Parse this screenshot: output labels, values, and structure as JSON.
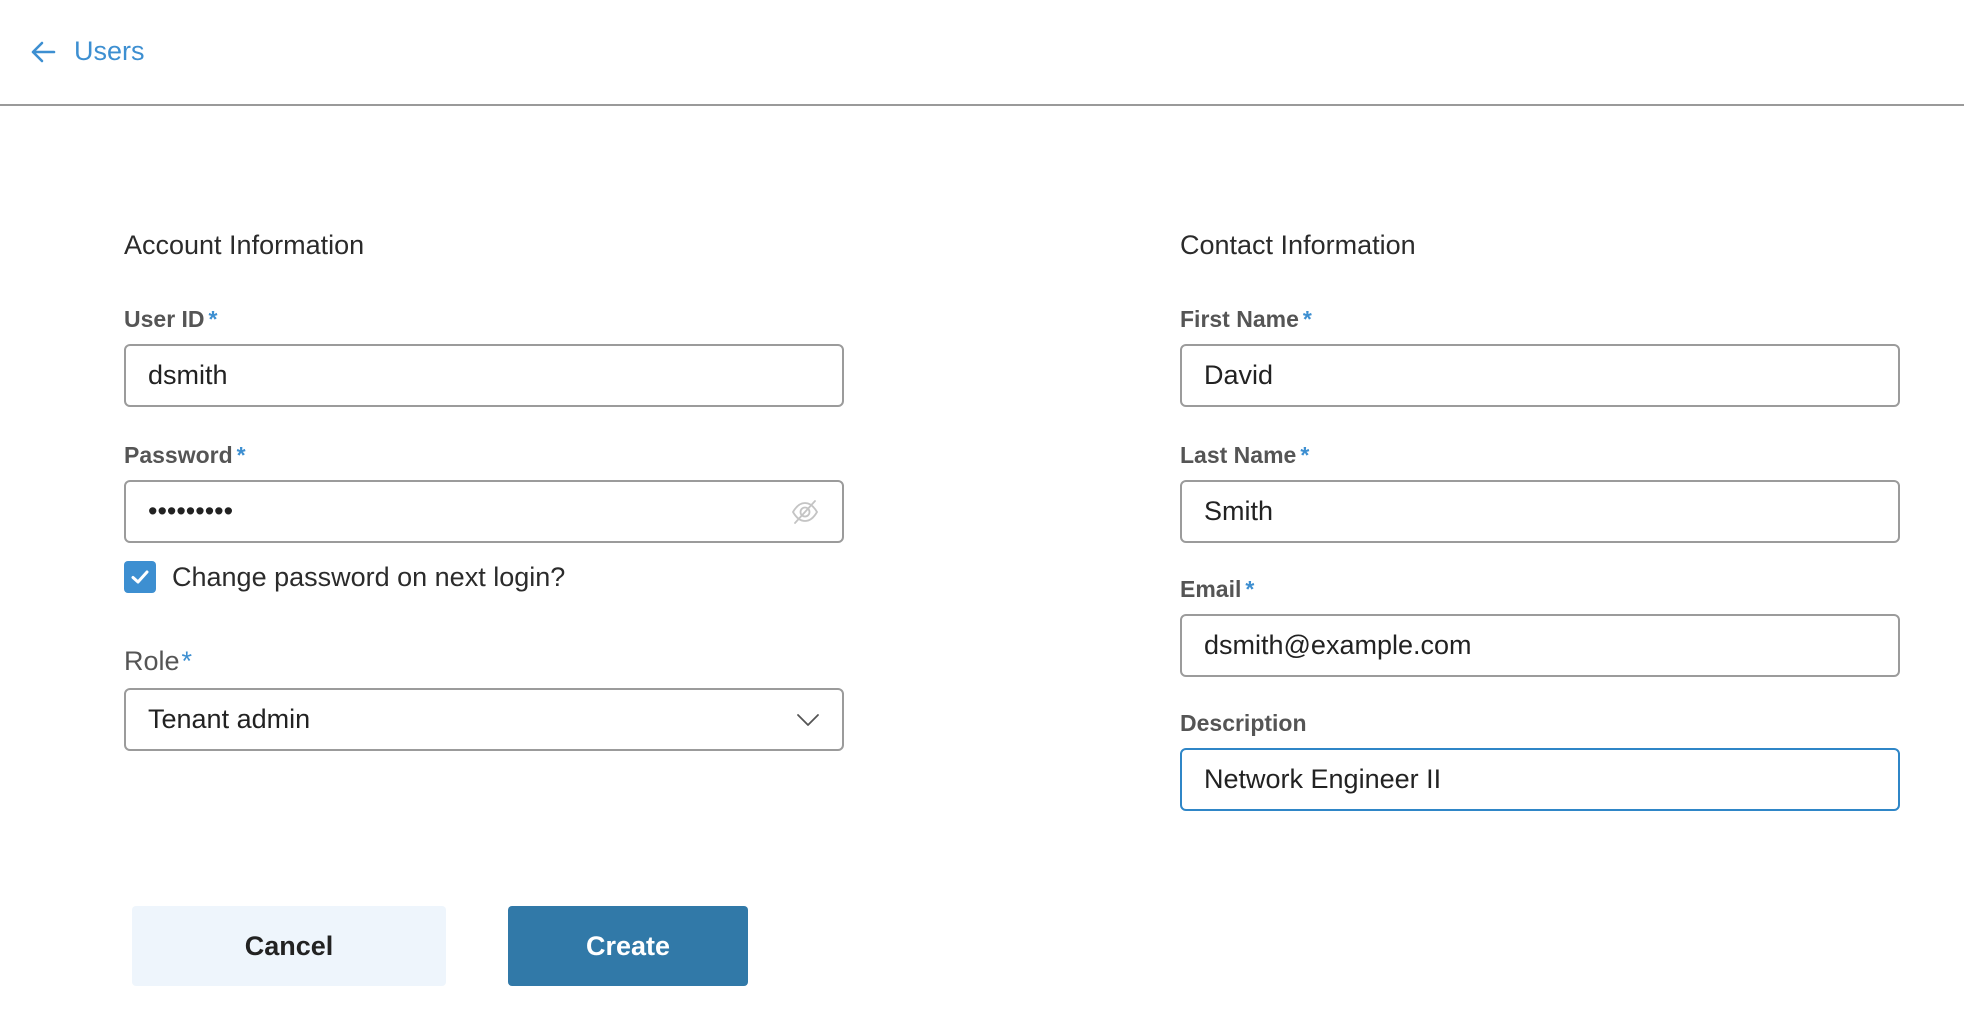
{
  "header": {
    "back_label": "Users",
    "back_icon": "arrow-left-icon"
  },
  "account": {
    "title": "Account Information",
    "user_id": {
      "label": "User ID",
      "required": "*",
      "value": "dsmith"
    },
    "password": {
      "label": "Password",
      "required": "*",
      "value": "•••••••••",
      "toggle_icon": "eye-slash-icon"
    },
    "change_password": {
      "label": "Change password on next login?",
      "checked": true
    },
    "role": {
      "label": "Role",
      "required": "*",
      "value": "Tenant admin",
      "dropdown_icon": "chevron-down-icon"
    }
  },
  "contact": {
    "title": "Contact Information",
    "first_name": {
      "label": "First Name",
      "required": "*",
      "value": "David"
    },
    "last_name": {
      "label": "Last Name",
      "required": "*",
      "value": "Smith"
    },
    "email": {
      "label": "Email",
      "required": "*",
      "value": "dsmith@example.com"
    },
    "description": {
      "label": "Description",
      "value": "Network Engineer II"
    }
  },
  "actions": {
    "cancel_label": "Cancel",
    "create_label": "Create"
  },
  "colors": {
    "accent": "#3d8fd1",
    "primary_button": "#3179a8",
    "secondary_button": "#eef5fc",
    "focus_border": "#2f86c7"
  }
}
